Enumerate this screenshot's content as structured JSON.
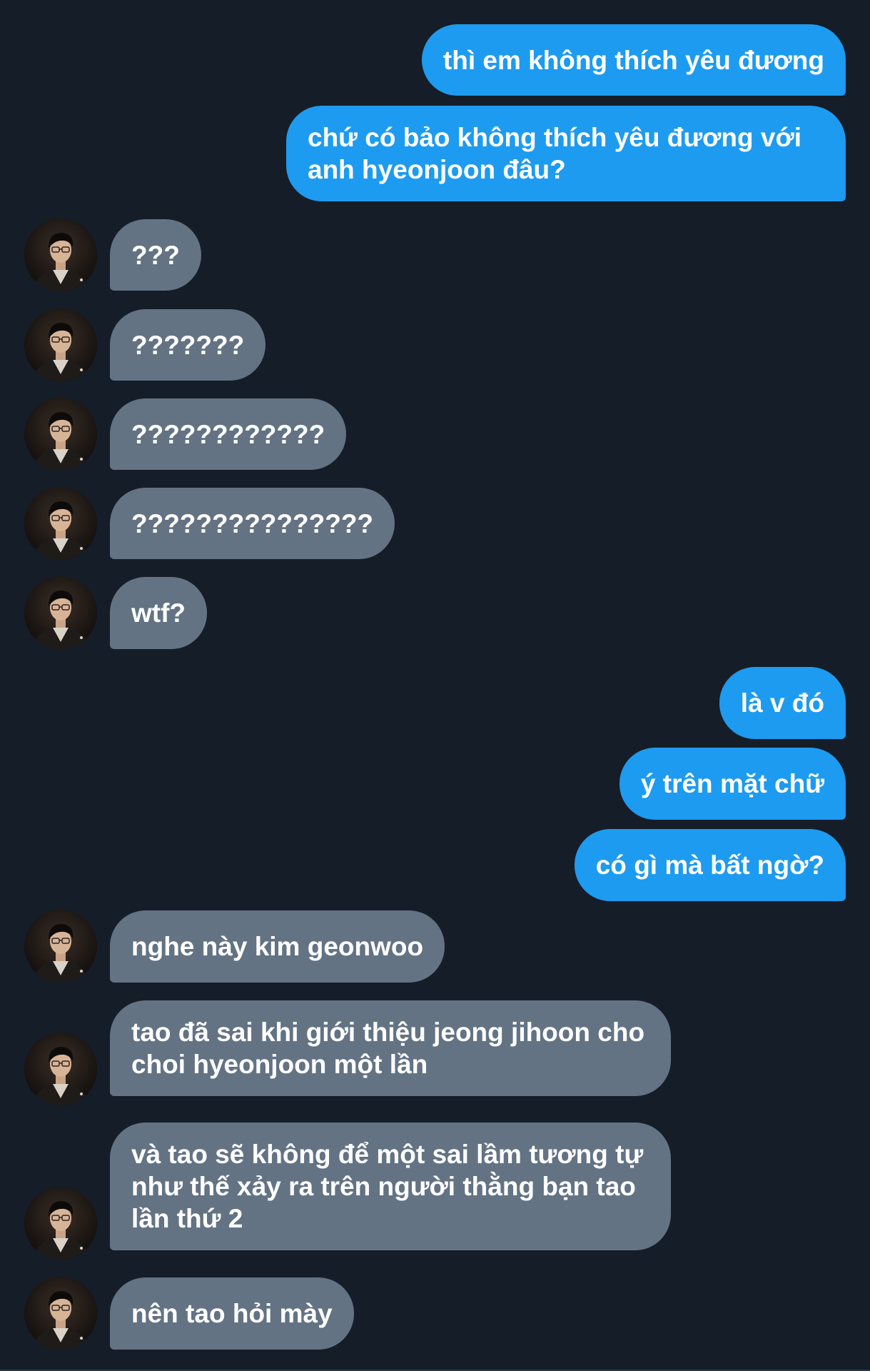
{
  "conversation": {
    "messages": [
      {
        "direction": "outgoing",
        "text": "thì em không thích yêu đương"
      },
      {
        "direction": "outgoing",
        "text": "chứ có bảo không thích yêu đương với anh hyeonjoon đâu?"
      },
      {
        "direction": "incoming",
        "text": "???"
      },
      {
        "direction": "incoming",
        "text": "???????"
      },
      {
        "direction": "incoming",
        "text": "????????????"
      },
      {
        "direction": "incoming",
        "text": "???????????????"
      },
      {
        "direction": "incoming",
        "text": "wtf?"
      },
      {
        "direction": "outgoing",
        "text": "là v đó"
      },
      {
        "direction": "outgoing",
        "text": "ý trên mặt chữ"
      },
      {
        "direction": "outgoing",
        "text": "có gì mà bất ngờ?"
      },
      {
        "direction": "incoming",
        "text": "nghe này kim geonwoo"
      },
      {
        "direction": "incoming",
        "text": "tao đã sai khi giới thiệu jeong jihoon cho choi hyeonjoon một lần"
      },
      {
        "direction": "incoming",
        "text": "và tao sẽ không để một sai lầm tương tự như thế xảy ra trên người thằng bạn tao lần thứ 2"
      },
      {
        "direction": "incoming",
        "text": "nên tao hỏi mày"
      }
    ]
  },
  "colors": {
    "background": "#151d28",
    "outgoing_bubble": "#1d9bf0",
    "incoming_bubble": "#637384",
    "text": "#ffffff"
  },
  "icons": {
    "contact_avatar": "avatar"
  }
}
